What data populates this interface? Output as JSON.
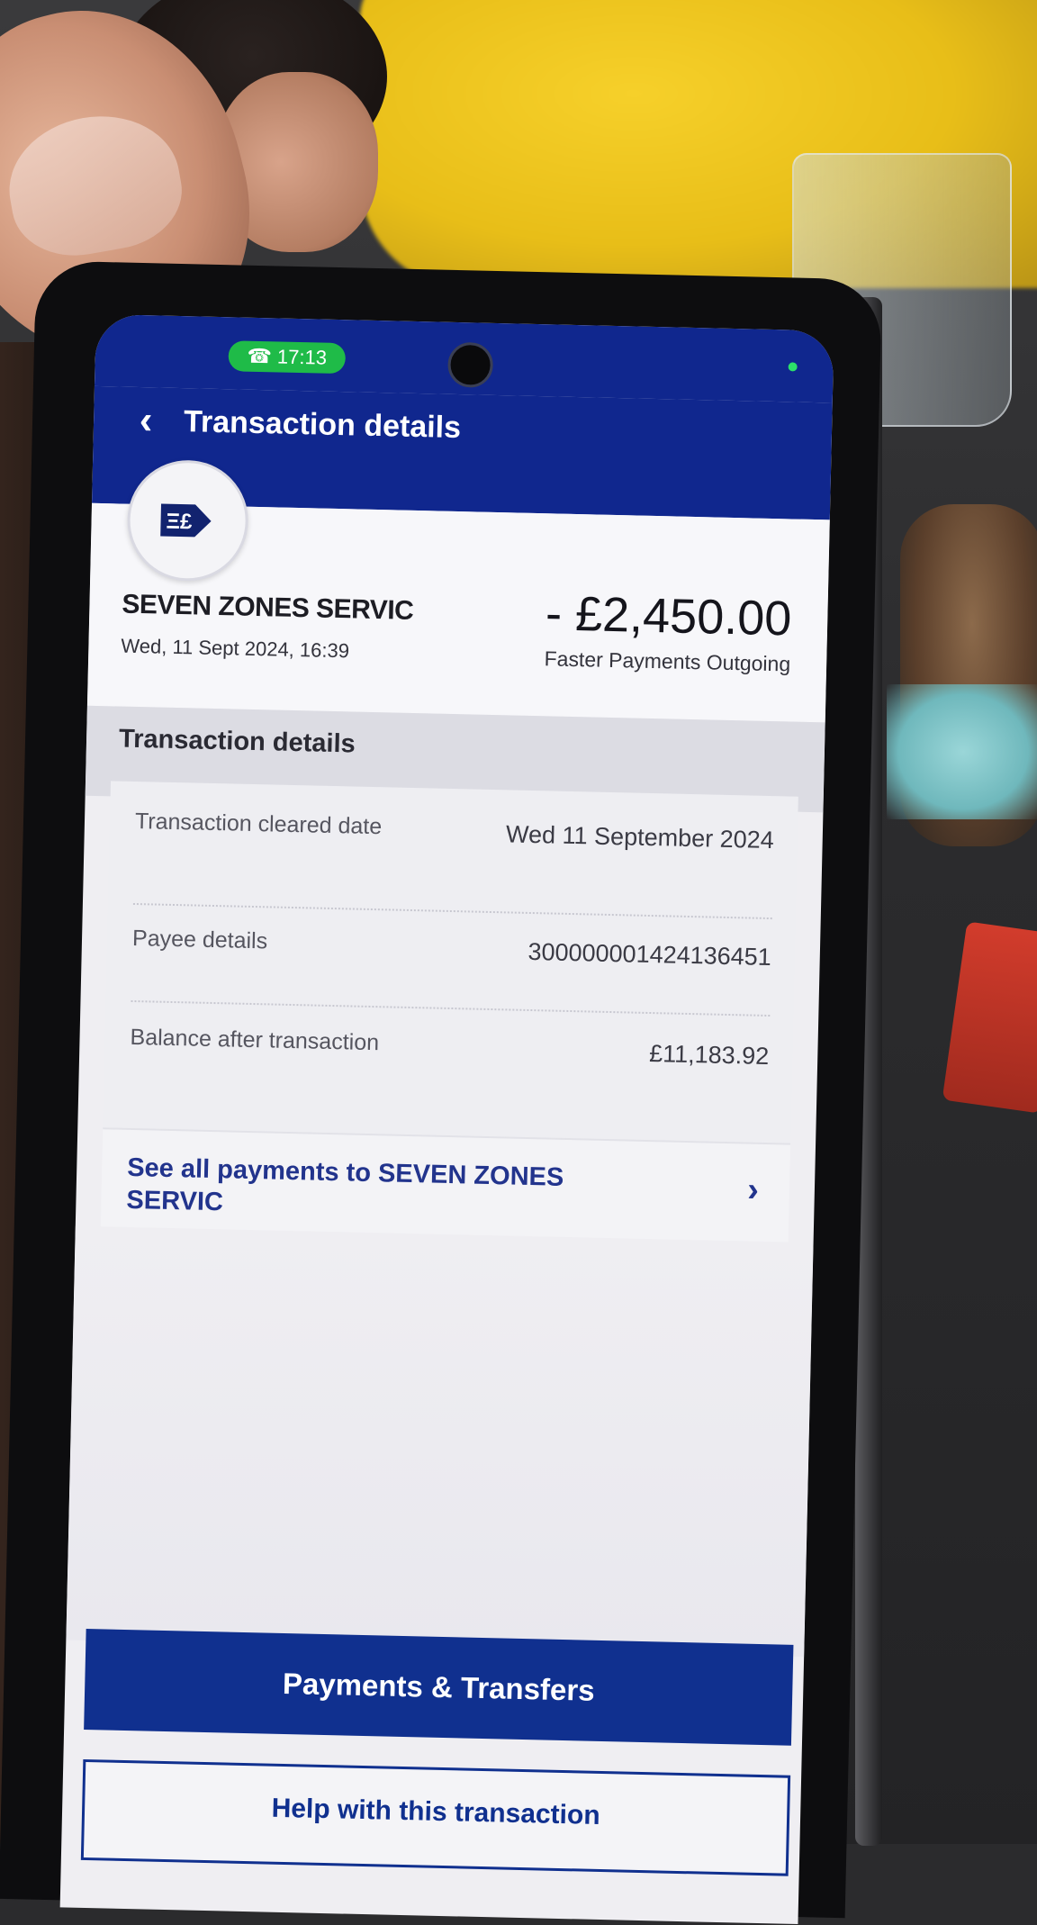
{
  "status_bar": {
    "call_time": "17:13",
    "accent_color": "#1fbb48"
  },
  "header": {
    "title": "Transaction details",
    "back_icon": "chevron-left-icon"
  },
  "transaction": {
    "payee_icon": "faster-payment-pound-arrow-icon",
    "merchant": "SEVEN ZONES SERVIC",
    "datetime": "Wed, 11 Sept 2024, 16:39",
    "amount": "- £2,450.00",
    "type": "Faster Payments Outgoing"
  },
  "details_section": {
    "title": "Transaction details",
    "rows": [
      {
        "label": "Transaction cleared date",
        "value": "Wed 11 September 2024"
      },
      {
        "label": "Payee details",
        "value": "300000001424136451"
      },
      {
        "label": "Balance after transaction",
        "value": "£11,183.92"
      }
    ],
    "see_all_link": "See all payments to SEVEN ZONES SERVIC"
  },
  "actions": {
    "primary": "Payments & Transfers",
    "secondary": "Help with this transaction"
  },
  "colors": {
    "brand_blue": "#10278e",
    "button_blue": "#10308f"
  }
}
